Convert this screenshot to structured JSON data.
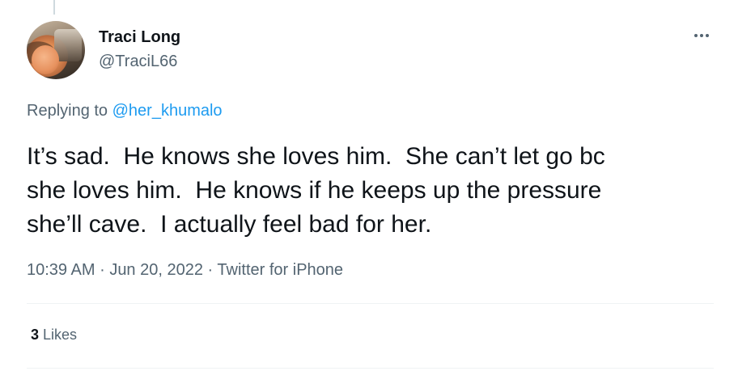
{
  "tweet": {
    "author": {
      "display_name": "Traci Long",
      "handle": "@TraciL66"
    },
    "replying_prefix": "Replying to",
    "replying_to": "@her_khumalo",
    "text": "It’s sad.  He knows she loves him.  She can’t let go bc\nshe loves him.  He knows if he keeps up the pressure\nshe’ll cave.  I actually feel bad for her.",
    "time": "10:39 AM",
    "date": "Jun 20, 2022",
    "source": "Twitter for iPhone",
    "separator": "·",
    "likes_count": "3",
    "likes_label": "Likes"
  },
  "icons": {
    "more": "more-horizontal-icon"
  },
  "colors": {
    "text_primary": "#0f1419",
    "text_secondary": "#536471",
    "link": "#1d9bf0",
    "divider": "#eff3f4"
  }
}
